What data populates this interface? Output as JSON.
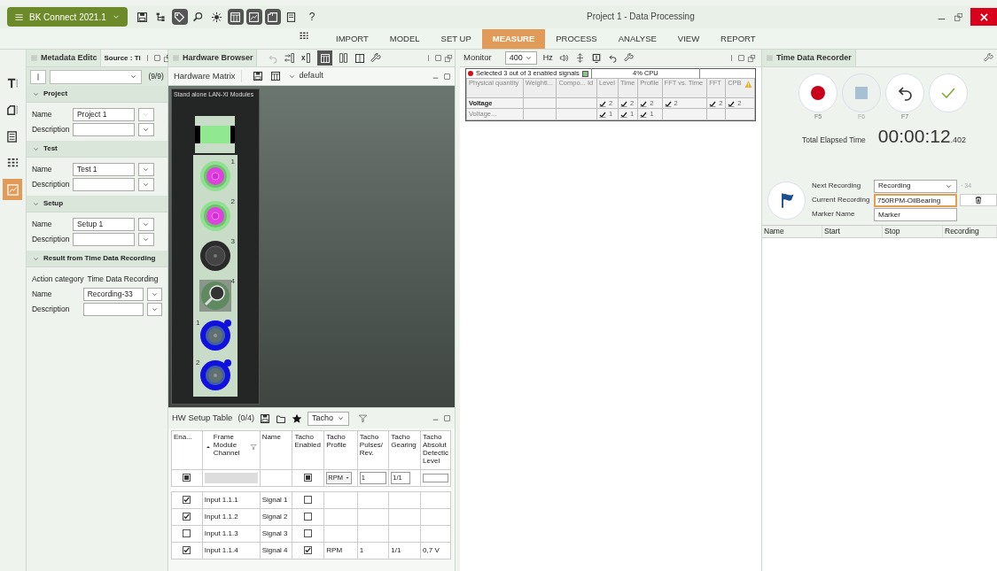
{
  "app_menu": {
    "label": "BK Connect 2021.1"
  },
  "toolbar": [
    {
      "kind": "save",
      "selected": false
    },
    {
      "kind": "tree",
      "selected": false
    },
    {
      "kind": "tag",
      "selected": true
    },
    {
      "kind": "search",
      "selected": false
    },
    {
      "kind": "sun",
      "selected": false
    },
    {
      "kind": "table",
      "selected": true
    },
    {
      "kind": "chart",
      "selected": true
    },
    {
      "kind": "window",
      "selected": true
    },
    {
      "kind": "doc",
      "selected": false
    }
  ],
  "help": "?",
  "window": {
    "title": "Project 1 - Data Processing"
  },
  "ribbon_tabs": [
    {
      "label": "IMPORT",
      "selected": false
    },
    {
      "label": "MODEL",
      "selected": false
    },
    {
      "label": "SET UP",
      "selected": false
    },
    {
      "label": "MEASURE",
      "selected": true
    },
    {
      "label": "PROCESS",
      "selected": false
    },
    {
      "label": "ANALYSE",
      "selected": false
    },
    {
      "label": "VIEW",
      "selected": false
    },
    {
      "label": "REPORT",
      "selected": false
    }
  ],
  "side_strip": [
    {
      "kind": "text",
      "selected": false
    },
    {
      "kind": "device",
      "selected": false
    },
    {
      "kind": "panel",
      "selected": false
    },
    {
      "kind": "matrix",
      "selected": false
    },
    {
      "kind": "chart",
      "selected": true
    }
  ],
  "metadata_panel": {
    "title": "Metadata Editc",
    "source_tab": "Source : Ti",
    "count": "(9/9)",
    "sections": [
      {
        "title": "Project",
        "fields": [
          {
            "label": "Name",
            "value": "Project 1",
            "disabled": true
          },
          {
            "label": "Description",
            "disabled": false
          }
        ]
      },
      {
        "title": "Test",
        "fields": [
          {
            "label": "Name",
            "value": "Test 1",
            "disabled": false
          },
          {
            "label": "Description",
            "disabled": false
          }
        ]
      },
      {
        "title": "Setup",
        "fields": [
          {
            "label": "Name",
            "value": "Setup 1",
            "disabled": false
          },
          {
            "label": "Description",
            "disabled": false
          }
        ]
      },
      {
        "title": "Result from Time Data Recording",
        "info": {
          "label": "Action category",
          "value": "Time Data Recording"
        },
        "fields": [
          {
            "label": "Name",
            "value": "Recording-33",
            "disabled": false
          },
          {
            "label": "Description",
            "disabled": false
          }
        ]
      }
    ]
  },
  "hardware_browser": {
    "title": "Hardware Browser",
    "matrix_title": "Hardware Matrix",
    "layout": "default",
    "module_label": "Stand alone LAN-XI Modules",
    "connectors": [
      {
        "number": "1",
        "kind": "signal"
      },
      {
        "number": "2",
        "kind": "signal"
      },
      {
        "number": "3",
        "kind": "idle"
      },
      {
        "number": "4",
        "kind": "search"
      },
      {
        "number": "1",
        "kind": "tacho"
      },
      {
        "number": "2",
        "kind": "tacho"
      }
    ]
  },
  "hw_setup_table": {
    "title": "HW Setup Table",
    "count": "(0/4)",
    "filter": "Tacho",
    "columns": [
      "Ena...",
      "Frame Module Channel",
      "Name",
      "Tacho Enabled",
      "Tacho Profile",
      "Tacho Pulses/ Rev.",
      "Tacho Gearing",
      "Tacho Absolut Detectic Level"
    ],
    "filter_row": {
      "enabled_mixed": true,
      "tacho_enabled_mixed": true,
      "profile": "RPM",
      "pulses": "1",
      "gearing": "1/1"
    },
    "rows": [
      {
        "enabled": true,
        "channel": "Input 1.1.1",
        "name": "Signal 1",
        "tacho_enabled": false
      },
      {
        "enabled": true,
        "channel": "Input 1.1.2",
        "name": "Signal 2",
        "tacho_enabled": false
      },
      {
        "enabled": false,
        "channel": "Input 1.1.3",
        "name": "Signal 3",
        "tacho_enabled": false
      },
      {
        "enabled": true,
        "channel": "Input 1.1.4",
        "name": "Signal 4",
        "tacho_enabled": true,
        "profile": "RPM",
        "pulses": "1",
        "gearing": "1/1",
        "level": "0,7 V"
      }
    ]
  },
  "monitor": {
    "title": "Monitor",
    "rate": "400",
    "unit": "Hz",
    "status": "Selected 3 out of 3 enabled signals",
    "cpu": "4% CPU",
    "columns": [
      "Physical quantity",
      "Weighti...",
      "Compo... Id",
      "Level",
      "Time",
      "Profile",
      "FFT vs. Time",
      "FFT",
      "CPB"
    ],
    "rows": [
      {
        "kind": "group",
        "quantity": "Voltage",
        "checks": [
          {
            "checked": true,
            "count": "2"
          },
          {
            "checked": true,
            "count": "2"
          },
          {
            "checked": true,
            "count": "2"
          },
          {
            "checked": true,
            "count": "2"
          },
          {
            "checked": true,
            "count": "2"
          },
          {
            "checked": true,
            "count": "2"
          }
        ]
      },
      {
        "kind": "child",
        "quantity": "Voltage...",
        "checks": [
          {
            "checked": true,
            "count": "1"
          },
          {
            "checked": true,
            "count": "1"
          },
          {
            "checked": true,
            "count": "1"
          }
        ]
      }
    ]
  },
  "recorder": {
    "title": "Time Data Recorder",
    "buttons": [
      {
        "kind": "record",
        "key": "F5",
        "disabled": false
      },
      {
        "kind": "stop",
        "key": "F6",
        "disabled": true
      },
      {
        "kind": "undo",
        "key": "F7",
        "disabled": false
      },
      {
        "kind": "accept",
        "disabled": false
      }
    ],
    "elapsed_label": "Total Elapsed Time",
    "elapsed": "00:00:12",
    "elapsed_ms": ".402",
    "next_recording": {
      "label": "Next Recording",
      "value": "Recording",
      "counter": "· 34"
    },
    "current_recording": {
      "label": "Current Recording",
      "value": "750RPM-OilBearing"
    },
    "marker": {
      "label": "Marker Name",
      "value": "Marker"
    },
    "columns": [
      "Name",
      "Start",
      "Stop",
      "Recording"
    ]
  }
}
